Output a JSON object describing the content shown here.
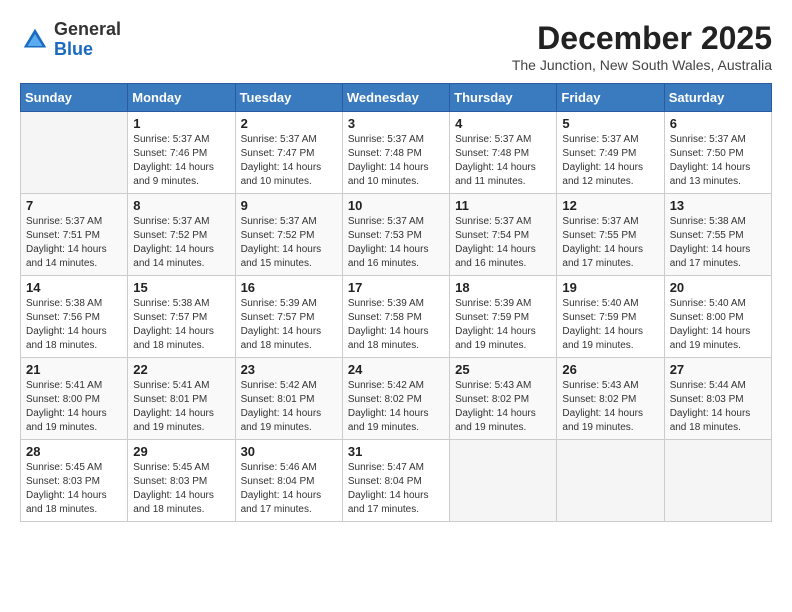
{
  "logo": {
    "general": "General",
    "blue": "Blue"
  },
  "header": {
    "month": "December 2025",
    "location": "The Junction, New South Wales, Australia"
  },
  "days_of_week": [
    "Sunday",
    "Monday",
    "Tuesday",
    "Wednesday",
    "Thursday",
    "Friday",
    "Saturday"
  ],
  "weeks": [
    [
      {
        "day": "",
        "info": ""
      },
      {
        "day": "1",
        "info": "Sunrise: 5:37 AM\nSunset: 7:46 PM\nDaylight: 14 hours\nand 9 minutes."
      },
      {
        "day": "2",
        "info": "Sunrise: 5:37 AM\nSunset: 7:47 PM\nDaylight: 14 hours\nand 10 minutes."
      },
      {
        "day": "3",
        "info": "Sunrise: 5:37 AM\nSunset: 7:48 PM\nDaylight: 14 hours\nand 10 minutes."
      },
      {
        "day": "4",
        "info": "Sunrise: 5:37 AM\nSunset: 7:48 PM\nDaylight: 14 hours\nand 11 minutes."
      },
      {
        "day": "5",
        "info": "Sunrise: 5:37 AM\nSunset: 7:49 PM\nDaylight: 14 hours\nand 12 minutes."
      },
      {
        "day": "6",
        "info": "Sunrise: 5:37 AM\nSunset: 7:50 PM\nDaylight: 14 hours\nand 13 minutes."
      }
    ],
    [
      {
        "day": "7",
        "info": "Sunrise: 5:37 AM\nSunset: 7:51 PM\nDaylight: 14 hours\nand 14 minutes."
      },
      {
        "day": "8",
        "info": "Sunrise: 5:37 AM\nSunset: 7:52 PM\nDaylight: 14 hours\nand 14 minutes."
      },
      {
        "day": "9",
        "info": "Sunrise: 5:37 AM\nSunset: 7:52 PM\nDaylight: 14 hours\nand 15 minutes."
      },
      {
        "day": "10",
        "info": "Sunrise: 5:37 AM\nSunset: 7:53 PM\nDaylight: 14 hours\nand 16 minutes."
      },
      {
        "day": "11",
        "info": "Sunrise: 5:37 AM\nSunset: 7:54 PM\nDaylight: 14 hours\nand 16 minutes."
      },
      {
        "day": "12",
        "info": "Sunrise: 5:37 AM\nSunset: 7:55 PM\nDaylight: 14 hours\nand 17 minutes."
      },
      {
        "day": "13",
        "info": "Sunrise: 5:38 AM\nSunset: 7:55 PM\nDaylight: 14 hours\nand 17 minutes."
      }
    ],
    [
      {
        "day": "14",
        "info": "Sunrise: 5:38 AM\nSunset: 7:56 PM\nDaylight: 14 hours\nand 18 minutes."
      },
      {
        "day": "15",
        "info": "Sunrise: 5:38 AM\nSunset: 7:57 PM\nDaylight: 14 hours\nand 18 minutes."
      },
      {
        "day": "16",
        "info": "Sunrise: 5:39 AM\nSunset: 7:57 PM\nDaylight: 14 hours\nand 18 minutes."
      },
      {
        "day": "17",
        "info": "Sunrise: 5:39 AM\nSunset: 7:58 PM\nDaylight: 14 hours\nand 18 minutes."
      },
      {
        "day": "18",
        "info": "Sunrise: 5:39 AM\nSunset: 7:59 PM\nDaylight: 14 hours\nand 19 minutes."
      },
      {
        "day": "19",
        "info": "Sunrise: 5:40 AM\nSunset: 7:59 PM\nDaylight: 14 hours\nand 19 minutes."
      },
      {
        "day": "20",
        "info": "Sunrise: 5:40 AM\nSunset: 8:00 PM\nDaylight: 14 hours\nand 19 minutes."
      }
    ],
    [
      {
        "day": "21",
        "info": "Sunrise: 5:41 AM\nSunset: 8:00 PM\nDaylight: 14 hours\nand 19 minutes."
      },
      {
        "day": "22",
        "info": "Sunrise: 5:41 AM\nSunset: 8:01 PM\nDaylight: 14 hours\nand 19 minutes."
      },
      {
        "day": "23",
        "info": "Sunrise: 5:42 AM\nSunset: 8:01 PM\nDaylight: 14 hours\nand 19 minutes."
      },
      {
        "day": "24",
        "info": "Sunrise: 5:42 AM\nSunset: 8:02 PM\nDaylight: 14 hours\nand 19 minutes."
      },
      {
        "day": "25",
        "info": "Sunrise: 5:43 AM\nSunset: 8:02 PM\nDaylight: 14 hours\nand 19 minutes."
      },
      {
        "day": "26",
        "info": "Sunrise: 5:43 AM\nSunset: 8:02 PM\nDaylight: 14 hours\nand 19 minutes."
      },
      {
        "day": "27",
        "info": "Sunrise: 5:44 AM\nSunset: 8:03 PM\nDaylight: 14 hours\nand 18 minutes."
      }
    ],
    [
      {
        "day": "28",
        "info": "Sunrise: 5:45 AM\nSunset: 8:03 PM\nDaylight: 14 hours\nand 18 minutes."
      },
      {
        "day": "29",
        "info": "Sunrise: 5:45 AM\nSunset: 8:03 PM\nDaylight: 14 hours\nand 18 minutes."
      },
      {
        "day": "30",
        "info": "Sunrise: 5:46 AM\nSunset: 8:04 PM\nDaylight: 14 hours\nand 17 minutes."
      },
      {
        "day": "31",
        "info": "Sunrise: 5:47 AM\nSunset: 8:04 PM\nDaylight: 14 hours\nand 17 minutes."
      },
      {
        "day": "",
        "info": ""
      },
      {
        "day": "",
        "info": ""
      },
      {
        "day": "",
        "info": ""
      }
    ]
  ]
}
